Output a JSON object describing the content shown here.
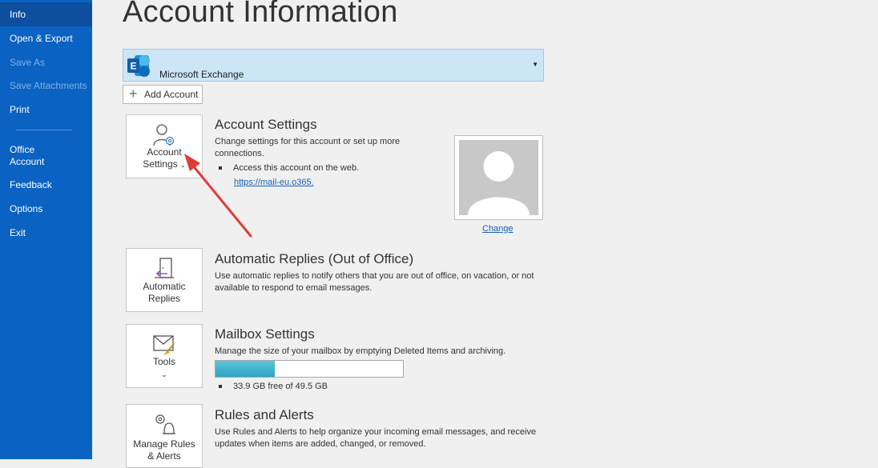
{
  "sidebar": {
    "items": [
      {
        "label": "Info",
        "state": "active"
      },
      {
        "label": "Open & Export",
        "state": "normal"
      },
      {
        "label": "Save As",
        "state": "disabled"
      },
      {
        "label": "Save Attachments",
        "state": "disabled"
      },
      {
        "label": "Print",
        "state": "normal"
      },
      {
        "label": "Office Account",
        "state": "normal"
      },
      {
        "label": "Feedback",
        "state": "normal"
      },
      {
        "label": "Options",
        "state": "normal"
      },
      {
        "label": "Exit",
        "state": "normal"
      }
    ]
  },
  "page_title": "Account Information",
  "account_selector": {
    "value": "Microsoft Exchange",
    "icon": "exchange-icon"
  },
  "add_account_label": "Add Account",
  "account_settings": {
    "tile_label_1": "Account",
    "tile_label_2": "Settings",
    "title": "Account Settings",
    "desc": "Change settings for this account or set up more connections.",
    "bullet": "Access this account on the web.",
    "link": "https://mail-eu.o365."
  },
  "profile": {
    "change_label": "Change"
  },
  "automatic_replies": {
    "tile_label_1": "Automatic",
    "tile_label_2": "Replies",
    "title": "Automatic Replies (Out of Office)",
    "desc": "Use automatic replies to notify others that you are out of office, on vacation, or not available to respond to email messages."
  },
  "mailbox_settings": {
    "tile_label": "Tools",
    "title": "Mailbox Settings",
    "desc": "Manage the size of your mailbox by emptying Deleted Items and archiving.",
    "usage_fraction": 0.315,
    "bullet": "33.9 GB free of 49.5 GB"
  },
  "rules_alerts": {
    "tile_label_1": "Manage Rules",
    "tile_label_2": "& Alerts",
    "title": "Rules and Alerts",
    "desc": "Use Rules and Alerts to help organize your incoming email messages, and receive updates when items are added, changed, or removed."
  },
  "colors": {
    "sidebar_bg": "#0a62c2",
    "active_item": "#0d4f9e",
    "selector_bg": "#cde6f7",
    "progress_fill": "#2ea3c3",
    "annotation_arrow": "#e03b35"
  }
}
